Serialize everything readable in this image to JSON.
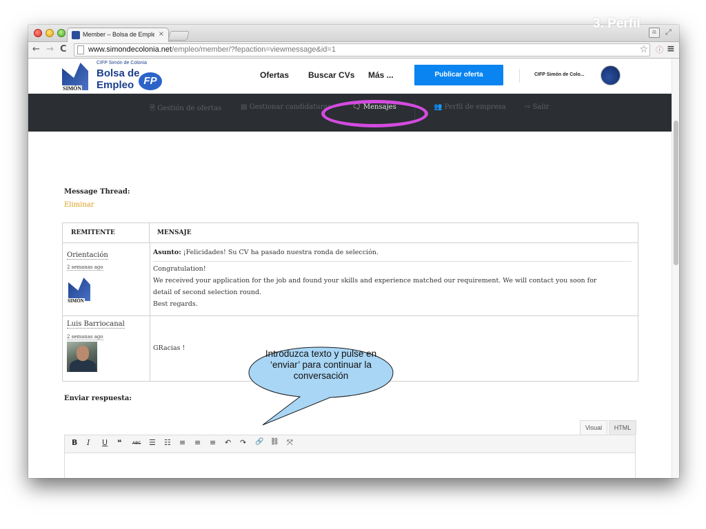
{
  "slide": {
    "title": "3. Perfil"
  },
  "browser": {
    "tab_title": "Member – Bolsa de Empleo",
    "tab_close": "×",
    "url_host": "www.simondecolonia.net",
    "url_path": "/empleo/member/?fepaction=viewmessage&id=1"
  },
  "header": {
    "logo_cifp": "CIFP Simón de Colonia",
    "logo_bolsa": "Bolsa de",
    "logo_empleo": "Empleo",
    "logo_simon": "SIMÓN",
    "logo_fp": "FP",
    "nav": [
      "Ofertas",
      "Buscar CVs",
      "Más ..."
    ],
    "publicar": "Publicar oferta",
    "account": "CIFP Simón de Colo..."
  },
  "subnav": {
    "items": [
      {
        "icon": "🗎",
        "label": "Gestión de ofertas"
      },
      {
        "icon": "▤",
        "label": "Gestionar candidaturas"
      },
      {
        "icon": "🗨",
        "label": "Mensajes"
      },
      {
        "icon": "👥",
        "label": "Perfil de empresa"
      },
      {
        "icon": "⇨",
        "label": "Salir"
      }
    ],
    "active_index": 2,
    "highlight_color": "#d34be0"
  },
  "thread": {
    "label": "Message Thread:",
    "delete_label": "Eliminar",
    "columns": [
      "REMITENTE",
      "MENSAJE"
    ],
    "messages": [
      {
        "sender": "Orientación",
        "time": "2 semanas ago",
        "subject_label": "Asunto:",
        "subject": " ¡Felicidades! Su CV ha pasado nuestra ronda de selección.",
        "lines": [
          "Congratulation!",
          "We received your application for the job and found your skills and experience matched our requirement. We will contact you soon for",
          "detail of second selection round.",
          "Best regards."
        ]
      },
      {
        "sender": "Luis Barriocanal",
        "time": "2 semanas ago",
        "body": "GRacias !"
      }
    ]
  },
  "reply": {
    "label": "Enviar respuesta:",
    "tab_visual": "Visual",
    "tab_html": "HTML",
    "tools": [
      "B",
      "I",
      "U",
      "❝",
      "ABC",
      "☰",
      "☷",
      "≡",
      "≡",
      "≡",
      "↶",
      "↷",
      "🔗",
      "⛓",
      "⤧"
    ]
  },
  "callout": {
    "text": "Introduzca texto y pulse en ‘enviar’ para continuar la conversación",
    "fill": "#a9d6f5",
    "stroke": "#1a1a1a"
  },
  "colors": {
    "brand": "#1b3e8c",
    "button": "#0a84f0",
    "subnav_bg": "#2b2e32",
    "link_orange": "#d99e1a"
  }
}
